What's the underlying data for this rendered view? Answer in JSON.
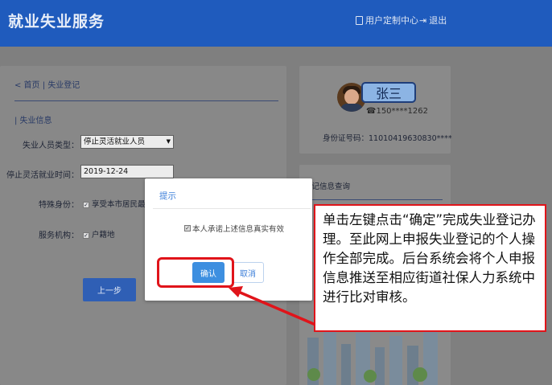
{
  "header": {
    "app_title": "就业失业服务",
    "user_center": "用户定制中心",
    "logout": "退出"
  },
  "breadcrumb": {
    "back": "< 首页",
    "separator": "|",
    "current": "失业登记"
  },
  "form": {
    "section_title": "| 失业信息",
    "unemployed_type_label": "失业人员类型：",
    "unemployed_type_value": "停止灵活就业人员",
    "stop_time_label": "停止灵活就业时间：",
    "stop_time_value": "2019-12-24",
    "special_identity_label": "特殊身份：",
    "special_identity_value": "享受本市居民最低",
    "service_org_label": "服务机构：",
    "service_org_value": "户籍地",
    "back_button": "上一步"
  },
  "profile": {
    "name": "张三",
    "phone": "☎150****1262",
    "id_card": "身份证号码：11010419630830****"
  },
  "query": {
    "title": "登记信息查询"
  },
  "dialog": {
    "title": "提示",
    "checkbox_label": "本人承诺上述信息真实有效",
    "ok": "确认",
    "cancel": "取消"
  },
  "callout": {
    "text": "单击左键点击“确定”完成失业登记办理。至此网上申报失业登记的个人操作全部完成。后台系统会将个人申报信息推送至相应街道社保人力系统中进行比对审核。"
  },
  "colors": {
    "header_blue": "#1f5bbd",
    "highlight_red": "#e0141a",
    "dialog_blue": "#3d8fe0"
  }
}
